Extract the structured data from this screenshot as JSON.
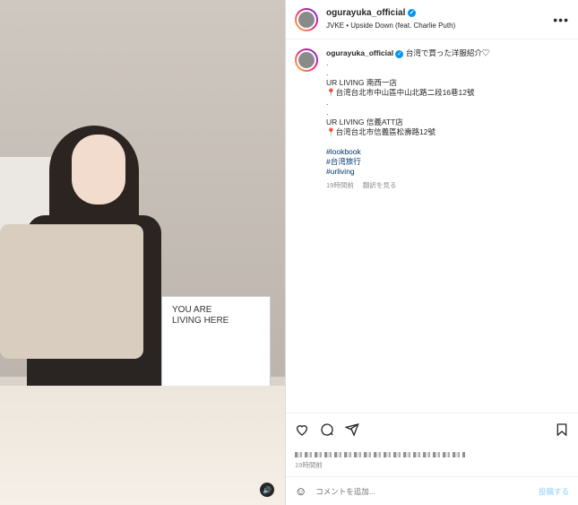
{
  "post": {
    "username": "ogurayuka_official",
    "audio": "JVKE • Upside Down (feat. Charlie Puth)",
    "more": "•••",
    "bag_text": [
      "YOU ARE",
      "LIVING HERE"
    ],
    "caption_lines": [
      "台湾で買った洋服紹介♡",
      ".",
      ".",
      "UR LIVING 南西一店",
      "📍台湾台北市中山區中山北路二段16巷12號",
      ".",
      ".",
      "UR LIVING 信義ATT店",
      "📍台湾台北市信義區松壽路12號",
      ""
    ],
    "hashtags": [
      "#lookbook",
      "#台湾旅行",
      "#urliving"
    ],
    "caption_time": "19時間前",
    "see_translation": "翻訳を見る",
    "post_time": "19時間前"
  },
  "comment": {
    "placeholder": "コメントを追加...",
    "post_label": "投稿する"
  },
  "icons": {
    "heart": "heart-icon",
    "comment": "comment-icon",
    "share": "share-icon",
    "save": "bookmark-icon",
    "emoji": "emoji-icon",
    "sound": "speaker-icon"
  },
  "colors": {
    "link": "#00376b",
    "verified": "#0095f6",
    "muted": "#8e8e8e"
  }
}
